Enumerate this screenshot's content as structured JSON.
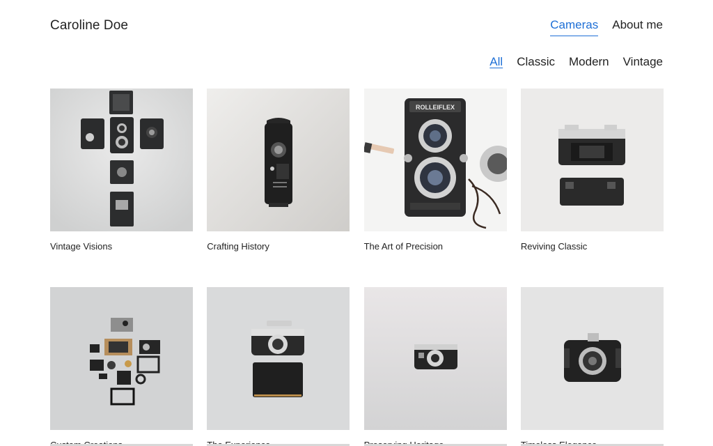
{
  "header": {
    "title": "Caroline Doe",
    "nav": [
      {
        "label": "Cameras",
        "active": true
      },
      {
        "label": "About me",
        "active": false
      }
    ]
  },
  "filters": [
    {
      "label": "All",
      "active": true
    },
    {
      "label": "Classic",
      "active": false
    },
    {
      "label": "Modern",
      "active": false
    },
    {
      "label": "Vintage",
      "active": false
    }
  ],
  "colors": {
    "accent": "#1e6fd6",
    "text": "#222222"
  },
  "gallery": [
    {
      "caption": "Vintage Visions",
      "icon": "camera-parts-cross-photo"
    },
    {
      "caption": "Crafting History",
      "icon": "movie-camera-photo"
    },
    {
      "caption": "The Art of Precision",
      "icon": "rolleiflex-camera-photo"
    },
    {
      "caption": "Reviving Classic",
      "icon": "rangefinder-camera-photo"
    },
    {
      "caption": "Custom Creations",
      "icon": "disassembled-camera-photo"
    },
    {
      "caption": "The Experience",
      "icon": "leica-camera-photo"
    },
    {
      "caption": "Preserving Heritage",
      "icon": "compact-camera-photo"
    },
    {
      "caption": "Timeless Elegance",
      "icon": "folding-camera-photo"
    }
  ],
  "photo_labels": {
    "rolleiflex_brand": "ROLLEIFLEX"
  }
}
